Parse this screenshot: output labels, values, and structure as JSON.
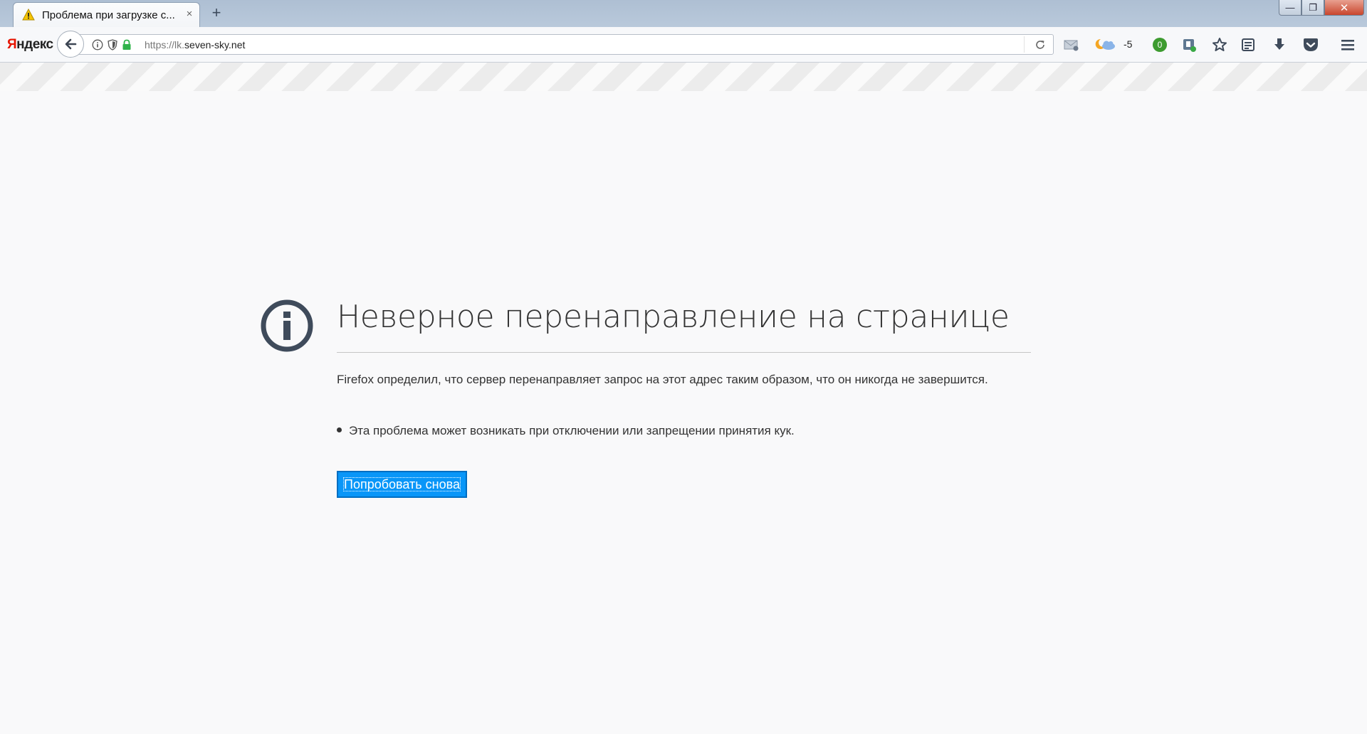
{
  "tab": {
    "title": "Проблема при загрузке с...",
    "close_label": "×",
    "new_tab_label": "+"
  },
  "window_controls": {
    "minimize": "—",
    "restore": "❐",
    "close": "✕"
  },
  "navbar": {
    "yandex_logo_first": "Я",
    "yandex_logo_rest": "ндекс",
    "url_scheme": "https://lk.",
    "url_host": "seven-sky.net",
    "weather_temp": "-5",
    "badge_count": "0"
  },
  "error": {
    "title": "Неверное перенаправление на странице",
    "description": "Firefox определил, что сервер перенаправляет запрос на этот адрес таким образом, что он никогда не завершится.",
    "bullet": "Эта проблема может возникать при отключении или запрещении принятия кук.",
    "try_again_label": "Попробовать снова"
  },
  "colors": {
    "accent_button": "#0996f8",
    "icon_dark": "#3f4b5b",
    "lock_green": "#2fb34a"
  }
}
